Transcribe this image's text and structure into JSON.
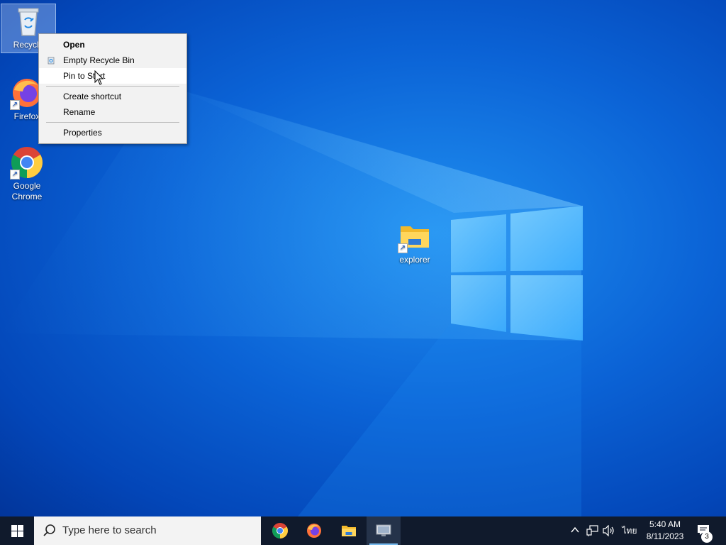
{
  "desktop": {
    "icons": [
      {
        "label": "Recycle Bin",
        "visible_label": "Recycle",
        "icon": "recycle-bin-icon"
      },
      {
        "label": "Firefox",
        "icon": "firefox-icon"
      },
      {
        "label": "Google Chrome",
        "line1": "Google",
        "line2": "Chrome",
        "icon": "chrome-icon"
      },
      {
        "label": "explorer",
        "icon": "folder-icon"
      }
    ]
  },
  "context_menu": {
    "items": [
      {
        "label": "Open",
        "bold": true
      },
      {
        "label": "Empty Recycle Bin",
        "icon": "recycle-bin-small-icon"
      },
      {
        "label": "Pin to Start",
        "highlighted": true
      },
      {
        "label": "Create shortcut"
      },
      {
        "label": "Rename"
      },
      {
        "label": "Properties"
      }
    ]
  },
  "taskbar": {
    "search_placeholder": "Type here to search",
    "pinned_apps": [
      {
        "name": "Google Chrome",
        "icon": "chrome-icon"
      },
      {
        "name": "Firefox",
        "icon": "firefox-icon"
      },
      {
        "name": "File Explorer",
        "icon": "folder-icon"
      },
      {
        "name": "Network app",
        "icon": "monitor-icon",
        "active": true
      }
    ],
    "tray": {
      "language": "ไทย",
      "time": "5:40 AM",
      "date": "8/11/2023",
      "notification_count": "3"
    }
  },
  "colors": {
    "desktop_blue": "#0b63d6",
    "taskbar": "#101a2c",
    "menu_bg": "#f2f2f2",
    "active_indicator": "#76b9ed"
  }
}
